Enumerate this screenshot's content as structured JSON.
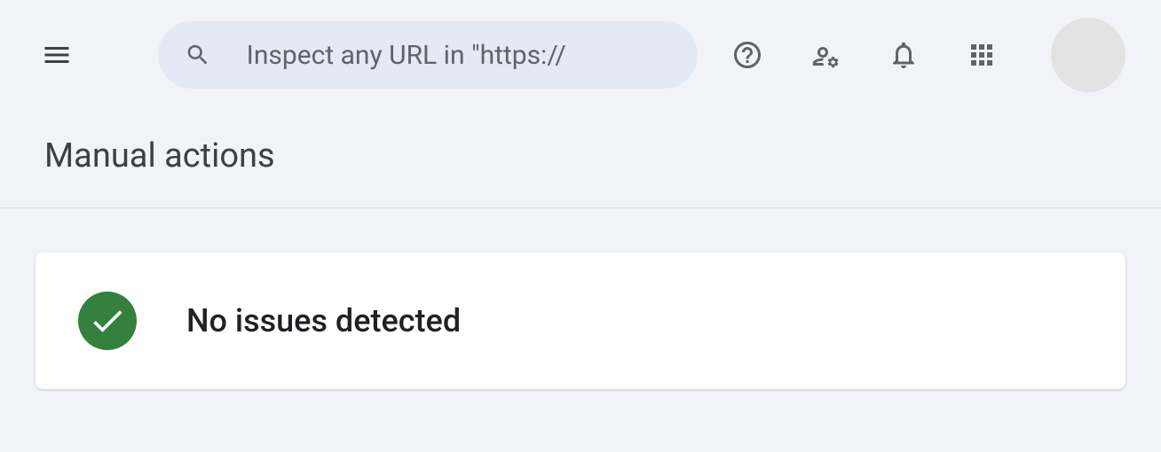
{
  "header": {
    "search_placeholder": "Inspect any URL in \"https://"
  },
  "page": {
    "title": "Manual actions"
  },
  "status": {
    "message": "No issues detected"
  }
}
